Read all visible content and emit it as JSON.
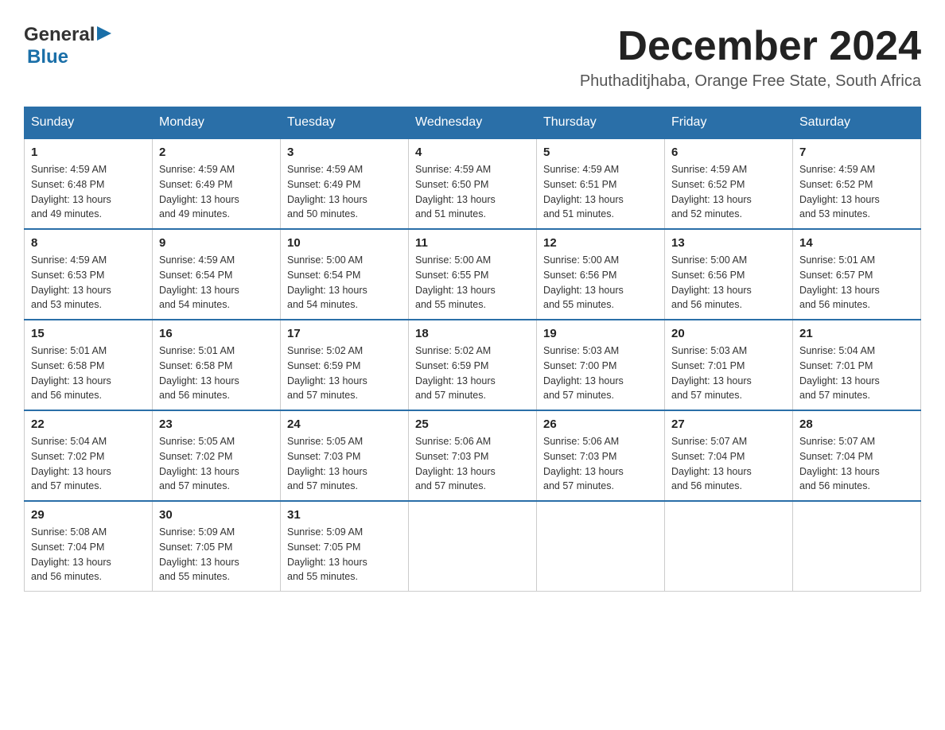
{
  "header": {
    "logo_general": "General",
    "logo_blue": "Blue",
    "month_title": "December 2024",
    "location": "Phuthaditjhaba, Orange Free State, South Africa"
  },
  "days_of_week": [
    "Sunday",
    "Monday",
    "Tuesday",
    "Wednesday",
    "Thursday",
    "Friday",
    "Saturday"
  ],
  "weeks": [
    [
      {
        "day": "1",
        "sunrise": "4:59 AM",
        "sunset": "6:48 PM",
        "daylight": "13 hours and 49 minutes."
      },
      {
        "day": "2",
        "sunrise": "4:59 AM",
        "sunset": "6:49 PM",
        "daylight": "13 hours and 49 minutes."
      },
      {
        "day": "3",
        "sunrise": "4:59 AM",
        "sunset": "6:49 PM",
        "daylight": "13 hours and 50 minutes."
      },
      {
        "day": "4",
        "sunrise": "4:59 AM",
        "sunset": "6:50 PM",
        "daylight": "13 hours and 51 minutes."
      },
      {
        "day": "5",
        "sunrise": "4:59 AM",
        "sunset": "6:51 PM",
        "daylight": "13 hours and 51 minutes."
      },
      {
        "day": "6",
        "sunrise": "4:59 AM",
        "sunset": "6:52 PM",
        "daylight": "13 hours and 52 minutes."
      },
      {
        "day": "7",
        "sunrise": "4:59 AM",
        "sunset": "6:52 PM",
        "daylight": "13 hours and 53 minutes."
      }
    ],
    [
      {
        "day": "8",
        "sunrise": "4:59 AM",
        "sunset": "6:53 PM",
        "daylight": "13 hours and 53 minutes."
      },
      {
        "day": "9",
        "sunrise": "4:59 AM",
        "sunset": "6:54 PM",
        "daylight": "13 hours and 54 minutes."
      },
      {
        "day": "10",
        "sunrise": "5:00 AM",
        "sunset": "6:54 PM",
        "daylight": "13 hours and 54 minutes."
      },
      {
        "day": "11",
        "sunrise": "5:00 AM",
        "sunset": "6:55 PM",
        "daylight": "13 hours and 55 minutes."
      },
      {
        "day": "12",
        "sunrise": "5:00 AM",
        "sunset": "6:56 PM",
        "daylight": "13 hours and 55 minutes."
      },
      {
        "day": "13",
        "sunrise": "5:00 AM",
        "sunset": "6:56 PM",
        "daylight": "13 hours and 56 minutes."
      },
      {
        "day": "14",
        "sunrise": "5:01 AM",
        "sunset": "6:57 PM",
        "daylight": "13 hours and 56 minutes."
      }
    ],
    [
      {
        "day": "15",
        "sunrise": "5:01 AM",
        "sunset": "6:58 PM",
        "daylight": "13 hours and 56 minutes."
      },
      {
        "day": "16",
        "sunrise": "5:01 AM",
        "sunset": "6:58 PM",
        "daylight": "13 hours and 56 minutes."
      },
      {
        "day": "17",
        "sunrise": "5:02 AM",
        "sunset": "6:59 PM",
        "daylight": "13 hours and 57 minutes."
      },
      {
        "day": "18",
        "sunrise": "5:02 AM",
        "sunset": "6:59 PM",
        "daylight": "13 hours and 57 minutes."
      },
      {
        "day": "19",
        "sunrise": "5:03 AM",
        "sunset": "7:00 PM",
        "daylight": "13 hours and 57 minutes."
      },
      {
        "day": "20",
        "sunrise": "5:03 AM",
        "sunset": "7:01 PM",
        "daylight": "13 hours and 57 minutes."
      },
      {
        "day": "21",
        "sunrise": "5:04 AM",
        "sunset": "7:01 PM",
        "daylight": "13 hours and 57 minutes."
      }
    ],
    [
      {
        "day": "22",
        "sunrise": "5:04 AM",
        "sunset": "7:02 PM",
        "daylight": "13 hours and 57 minutes."
      },
      {
        "day": "23",
        "sunrise": "5:05 AM",
        "sunset": "7:02 PM",
        "daylight": "13 hours and 57 minutes."
      },
      {
        "day": "24",
        "sunrise": "5:05 AM",
        "sunset": "7:03 PM",
        "daylight": "13 hours and 57 minutes."
      },
      {
        "day": "25",
        "sunrise": "5:06 AM",
        "sunset": "7:03 PM",
        "daylight": "13 hours and 57 minutes."
      },
      {
        "day": "26",
        "sunrise": "5:06 AM",
        "sunset": "7:03 PM",
        "daylight": "13 hours and 57 minutes."
      },
      {
        "day": "27",
        "sunrise": "5:07 AM",
        "sunset": "7:04 PM",
        "daylight": "13 hours and 56 minutes."
      },
      {
        "day": "28",
        "sunrise": "5:07 AM",
        "sunset": "7:04 PM",
        "daylight": "13 hours and 56 minutes."
      }
    ],
    [
      {
        "day": "29",
        "sunrise": "5:08 AM",
        "sunset": "7:04 PM",
        "daylight": "13 hours and 56 minutes."
      },
      {
        "day": "30",
        "sunrise": "5:09 AM",
        "sunset": "7:05 PM",
        "daylight": "13 hours and 55 minutes."
      },
      {
        "day": "31",
        "sunrise": "5:09 AM",
        "sunset": "7:05 PM",
        "daylight": "13 hours and 55 minutes."
      },
      null,
      null,
      null,
      null
    ]
  ],
  "labels": {
    "sunrise": "Sunrise:",
    "sunset": "Sunset:",
    "daylight": "Daylight:"
  }
}
